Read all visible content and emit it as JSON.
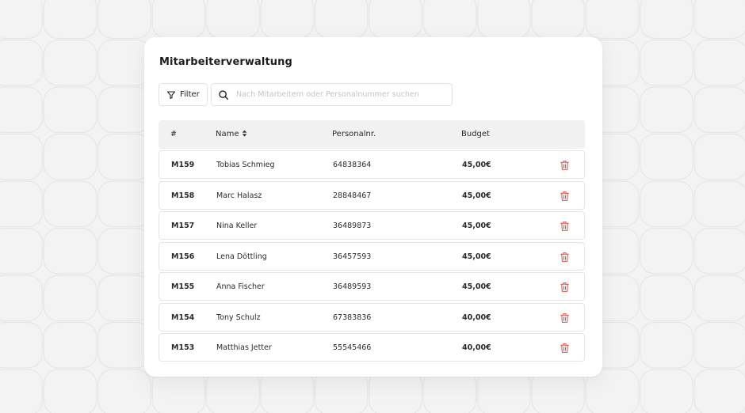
{
  "page": {
    "title": "Mitarbeiterverwaltung"
  },
  "toolbar": {
    "filter_label": "Filter",
    "search_placeholder": "Nach Mitarbeitern oder Personalnummer suchen",
    "search_value": ""
  },
  "table": {
    "columns": [
      "#",
      "Name",
      "Personalnr.",
      "Budget"
    ],
    "rows": [
      {
        "id": "M159",
        "name": "Tobias Schmieg",
        "personalnr": "64838364",
        "budget": "45,00€"
      },
      {
        "id": "M158",
        "name": "Marc Halasz",
        "personalnr": "28848467",
        "budget": "45,00€"
      },
      {
        "id": "M157",
        "name": "Nina Keller",
        "personalnr": "36489873",
        "budget": "45,00€"
      },
      {
        "id": "M156",
        "name": "Lena Döttling",
        "personalnr": "36457593",
        "budget": "45,00€"
      },
      {
        "id": "M155",
        "name": "Anna Fischer",
        "personalnr": "36489593",
        "budget": "45,00€"
      },
      {
        "id": "M154",
        "name": "Tony Schulz",
        "personalnr": "67383836",
        "budget": "40,00€"
      },
      {
        "id": "M153",
        "name": "Matthias Jetter",
        "personalnr": "55545466",
        "budget": "40,00€"
      }
    ]
  },
  "icons": {
    "filter": "filter-icon",
    "search": "search-icon",
    "sort": "sort-icon",
    "delete": "trash-icon"
  },
  "colors": {
    "background": "#f3f3f3",
    "card": "#ffffff",
    "header_row": "#f1f1f1",
    "delete_icon": "#e5534b",
    "text": "#1d1d1f"
  }
}
